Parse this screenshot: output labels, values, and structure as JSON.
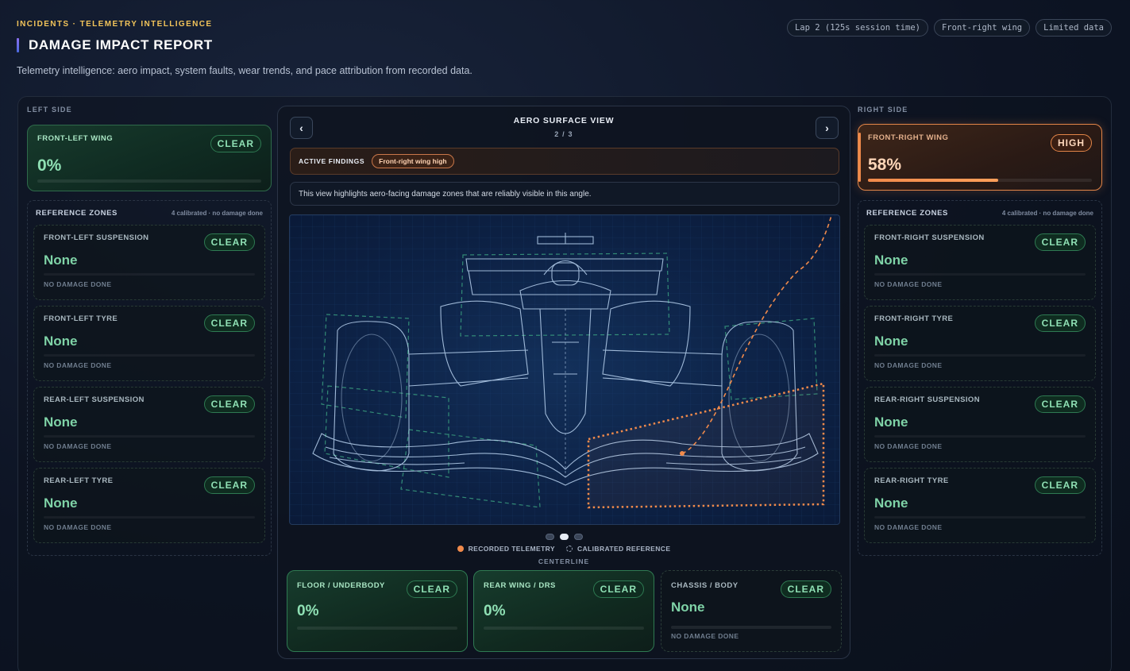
{
  "header": {
    "eyebrow": "INCIDENTS · TELEMETRY INTELLIGENCE",
    "title": "DAMAGE IMPACT REPORT",
    "subtitle": "Telemetry intelligence: aero impact, system faults, wear trends, and pace attribution from recorded data.",
    "chips": [
      "Lap 2 (125s session time)",
      "Front-right wing",
      "Limited data"
    ]
  },
  "left": {
    "label": "LEFT SIDE",
    "wing": {
      "name": "FRONT-LEFT WING",
      "value": "0%",
      "status": "CLEAR",
      "level": 0
    },
    "reference": {
      "title": "REFERENCE ZONES",
      "note": "4 calibrated · no damage done",
      "zones": [
        {
          "name": "FRONT-LEFT SUSPENSION",
          "value": "None",
          "status": "CLEAR",
          "foot": "NO DAMAGE DONE"
        },
        {
          "name": "FRONT-LEFT TYRE",
          "value": "None",
          "status": "CLEAR",
          "foot": "NO DAMAGE DONE"
        },
        {
          "name": "REAR-LEFT SUSPENSION",
          "value": "None",
          "status": "CLEAR",
          "foot": "NO DAMAGE DONE"
        },
        {
          "name": "REAR-LEFT TYRE",
          "value": "None",
          "status": "CLEAR",
          "foot": "NO DAMAGE DONE"
        }
      ]
    }
  },
  "right": {
    "label": "RIGHT SIDE",
    "wing": {
      "name": "FRONT-RIGHT WING",
      "value": "58%",
      "status": "HIGH",
      "level": 0.58
    },
    "reference": {
      "title": "REFERENCE ZONES",
      "note": "4 calibrated · no damage done",
      "zones": [
        {
          "name": "FRONT-RIGHT SUSPENSION",
          "value": "None",
          "status": "CLEAR",
          "foot": "NO DAMAGE DONE"
        },
        {
          "name": "FRONT-RIGHT TYRE",
          "value": "None",
          "status": "CLEAR",
          "foot": "NO DAMAGE DONE"
        },
        {
          "name": "REAR-RIGHT SUSPENSION",
          "value": "None",
          "status": "CLEAR",
          "foot": "NO DAMAGE DONE"
        },
        {
          "name": "REAR-RIGHT TYRE",
          "value": "None",
          "status": "CLEAR",
          "foot": "NO DAMAGE DONE"
        }
      ]
    }
  },
  "center": {
    "prev_icon": "chevron-left-icon",
    "next_icon": "chevron-right-icon",
    "prev_glyph": "‹",
    "next_glyph": "›",
    "view_title": "AERO SURFACE VIEW",
    "view_page": "2 / 3",
    "current_view": 2,
    "total_views": 3,
    "findings_label": "ACTIVE FINDINGS",
    "findings_pill": "Front-right wing high",
    "view_note": "This view highlights aero-facing damage zones that are reliably visible in this angle.",
    "legend": {
      "recorded": "RECORDED TELEMETRY",
      "reference": "CALIBRATED REFERENCE"
    },
    "centerline": "CENTERLINE",
    "bottom_cards": [
      {
        "name": "FLOOR / UNDERBODY",
        "value": "0%",
        "status": "CLEAR",
        "level": 0
      },
      {
        "name": "REAR WING / DRS",
        "value": "0%",
        "status": "CLEAR",
        "level": 0
      },
      {
        "name": "CHASSIS / BODY",
        "value": "None",
        "status": "CLEAR",
        "foot": "NO DAMAGE DONE"
      }
    ]
  },
  "colors": {
    "accent_high": "#f08a4b",
    "clear_green": "#8fe0b4",
    "eyebrow_gold": "#f2c45a",
    "blueprint_bg": "#0d2246"
  }
}
